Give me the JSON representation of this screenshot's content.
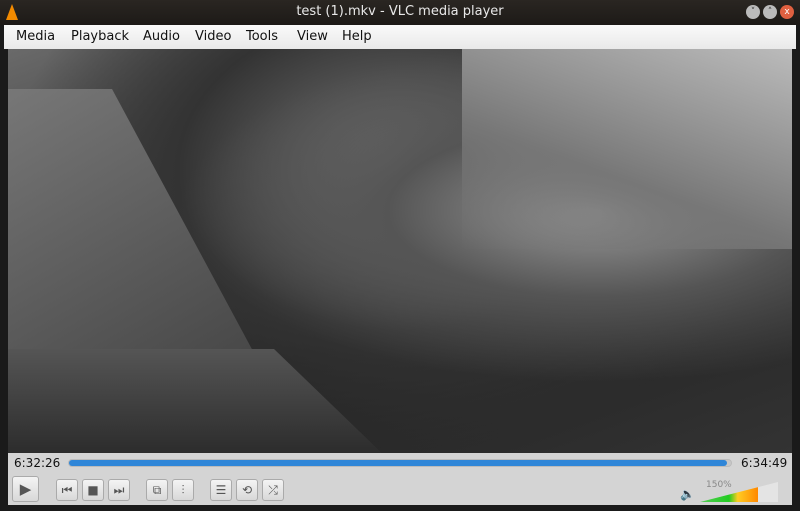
{
  "window": {
    "title": "test (1).mkv - VLC media player",
    "min": "˅",
    "max": "˄",
    "close": "x"
  },
  "menu": [
    "Media",
    "Playback",
    "Audio",
    "Video",
    "Tools",
    "View",
    "Help"
  ],
  "player": {
    "elapsed": "6:32:26",
    "total": "6:34:49",
    "progress_percent": 99.4,
    "volume_label": "150%",
    "volume_fraction": 0.74,
    "accent": "#2f86d8"
  },
  "buttons": {
    "play": "▶",
    "prev": "⏮",
    "stop": "■",
    "next": "⏭",
    "fullscreen": "⧉",
    "extended": "⫶",
    "playlist": "☰",
    "loop": "⟲",
    "shuffle": "⤮",
    "speaker": "🔈"
  }
}
